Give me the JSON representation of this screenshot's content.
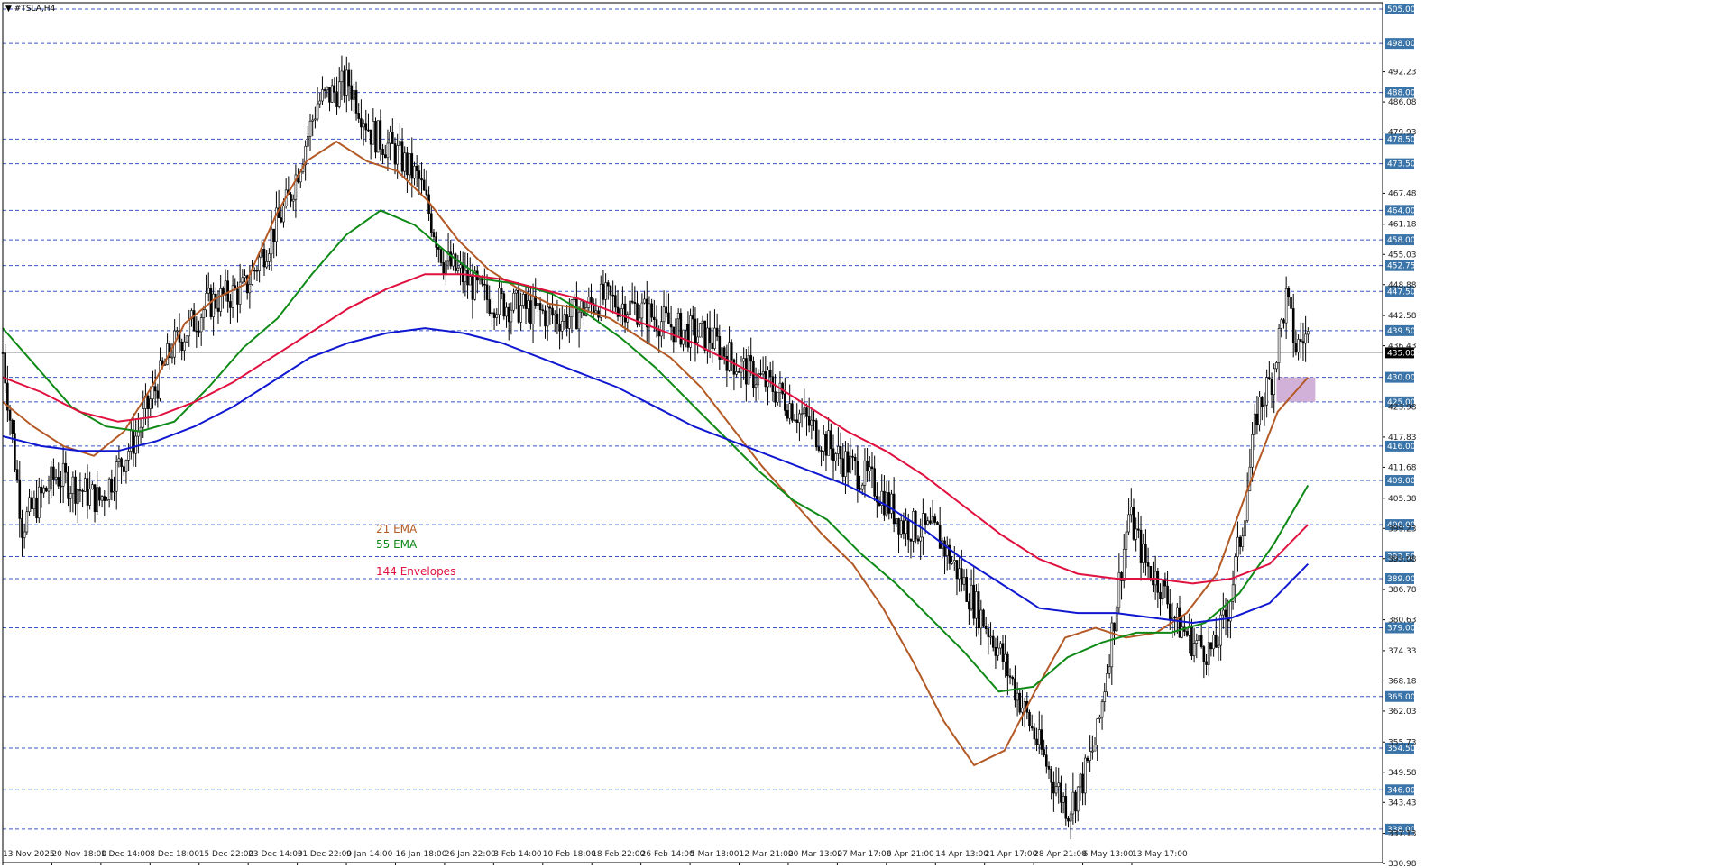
{
  "chart_title": "#TSLA,H4",
  "chart_data": {
    "type": "candlestick",
    "symbol": "#TSLA,H4",
    "ylim": [
      330.98,
      506.0
    ],
    "y_ticks": [
      "492.23",
      "486.08",
      "479.93",
      "467.48",
      "461.18",
      "455.03",
      "448.88",
      "442.58",
      "436.43",
      "423.98",
      "417.83",
      "411.68",
      "405.38",
      "399.23",
      "393.08",
      "386.78",
      "380.63",
      "374.33",
      "368.18",
      "362.03",
      "355.73",
      "349.58",
      "343.43",
      "337.13",
      "330.98"
    ],
    "x_labels": [
      "13 Nov 2025",
      "20 Nov 18:00",
      "1 Dec 14:00",
      "8 Dec 18:00",
      "15 Dec 22:00",
      "23 Dec 14:00",
      "31 Dec 22:00",
      "9 Jan 14:00",
      "16 Jan 18:00",
      "26 Jan 22:00",
      "3 Feb 14:00",
      "10 Feb 18:00",
      "18 Feb 22:00",
      "26 Feb 14:00",
      "5 Mar 18:00",
      "12 Mar 21:00",
      "20 Mar 13:00",
      "27 Mar 17:00",
      "6 Apr 21:00",
      "14 Apr 13:00",
      "21 Apr 17:00",
      "28 Apr 21:00",
      "6 May 13:00",
      "13 May 17:00"
    ],
    "levels": [
      "505.00",
      "498.00",
      "488.00",
      "478.50",
      "473.50",
      "464.00",
      "458.00",
      "452.75",
      "447.50",
      "439.50",
      "430.00",
      "425.00",
      "416.00",
      "409.00",
      "400.00",
      "393.50",
      "389.00",
      "379.00",
      "365.00",
      "354.50",
      "346.00",
      "338.00"
    ],
    "current_price": "435.00",
    "price_path": [
      [
        0,
        435
      ],
      [
        8,
        400
      ],
      [
        22,
        410
      ],
      [
        40,
        405
      ],
      [
        55,
        418
      ],
      [
        70,
        436
      ],
      [
        85,
        445
      ],
      [
        100,
        448
      ],
      [
        118,
        466
      ],
      [
        130,
        486
      ],
      [
        143,
        490
      ],
      [
        152,
        480
      ],
      [
        162,
        476
      ],
      [
        172,
        470
      ],
      [
        182,
        454
      ],
      [
        200,
        446
      ],
      [
        215,
        444
      ],
      [
        232,
        442
      ],
      [
        248,
        446
      ],
      [
        262,
        444
      ],
      [
        278,
        440
      ],
      [
        292,
        438
      ],
      [
        305,
        432
      ],
      [
        318,
        428
      ],
      [
        330,
        422
      ],
      [
        345,
        414
      ],
      [
        360,
        408
      ],
      [
        372,
        400
      ],
      [
        386,
        398
      ],
      [
        398,
        387
      ],
      [
        410,
        376
      ],
      [
        422,
        362
      ],
      [
        432,
        350
      ],
      [
        440,
        342
      ],
      [
        446,
        348
      ],
      [
        452,
        357
      ],
      [
        458,
        378
      ],
      [
        465,
        402
      ],
      [
        472,
        392
      ],
      [
        478,
        388
      ],
      [
        485,
        380
      ],
      [
        492,
        376
      ],
      [
        500,
        374
      ],
      [
        506,
        383
      ],
      [
        512,
        400
      ],
      [
        518,
        423
      ],
      [
        524,
        430
      ],
      [
        530,
        446
      ],
      [
        534,
        436
      ],
      [
        537,
        438
      ]
    ],
    "candles": {
      "open": [],
      "high": [],
      "low": [],
      "close": []
    },
    "series": [
      {
        "name": "21 EMA",
        "color": "#b35a26",
        "values": [
          425,
          420,
          416,
          414,
          419,
          429,
          441,
          446,
          449,
          463,
          474,
          478,
          474,
          472,
          466,
          458,
          452,
          448,
          445,
          444,
          442,
          438,
          434,
          428,
          420,
          412,
          405,
          398,
          392,
          383,
          372,
          360,
          351,
          354,
          366,
          377,
          379,
          377,
          378,
          382,
          390,
          407,
          423,
          430
        ]
      },
      {
        "name": "55 EMA",
        "color": "#0f8a17",
        "values": [
          440,
          432,
          424,
          420,
          419,
          421,
          428,
          436,
          442,
          451,
          459,
          464,
          461,
          455,
          450,
          449,
          447,
          443,
          438,
          432,
          425,
          418,
          411,
          405,
          401,
          394,
          388,
          381,
          374,
          366,
          367,
          373,
          376,
          378,
          378,
          380,
          386,
          396,
          408
        ]
      },
      {
        "name": "144 Envelopes",
        "color": "#e0113f",
        "values": [
          430,
          427,
          423,
          421,
          422,
          425,
          429,
          434,
          439,
          444,
          448,
          451,
          451,
          450,
          448,
          446,
          443,
          440,
          437,
          433,
          429,
          424,
          419,
          415,
          410,
          404,
          398,
          393,
          390,
          389,
          389,
          388,
          389,
          392,
          400
        ]
      },
      {
        "name": "",
        "color": "#0f18d0",
        "values": [
          418,
          416,
          415,
          415,
          417,
          420,
          424,
          429,
          434,
          437,
          439,
          440,
          439,
          437,
          434,
          431,
          428,
          424,
          420,
          417,
          414,
          411,
          408,
          404,
          399,
          393,
          388,
          383,
          382,
          382,
          381,
          380,
          381,
          384,
          392
        ]
      }
    ],
    "zone": {
      "x_range": [
        6,
        13
      ],
      "y_range": [
        425,
        430
      ],
      "color": "#c9a3d1"
    },
    "legend": [
      {
        "label": "21 EMA",
        "color": "#b35a26"
      },
      {
        "label": "55 EMA",
        "color": "#0f8a17"
      },
      {
        "label": "144 Envelopes",
        "color": "#e0113f"
      }
    ],
    "grid": false
  }
}
